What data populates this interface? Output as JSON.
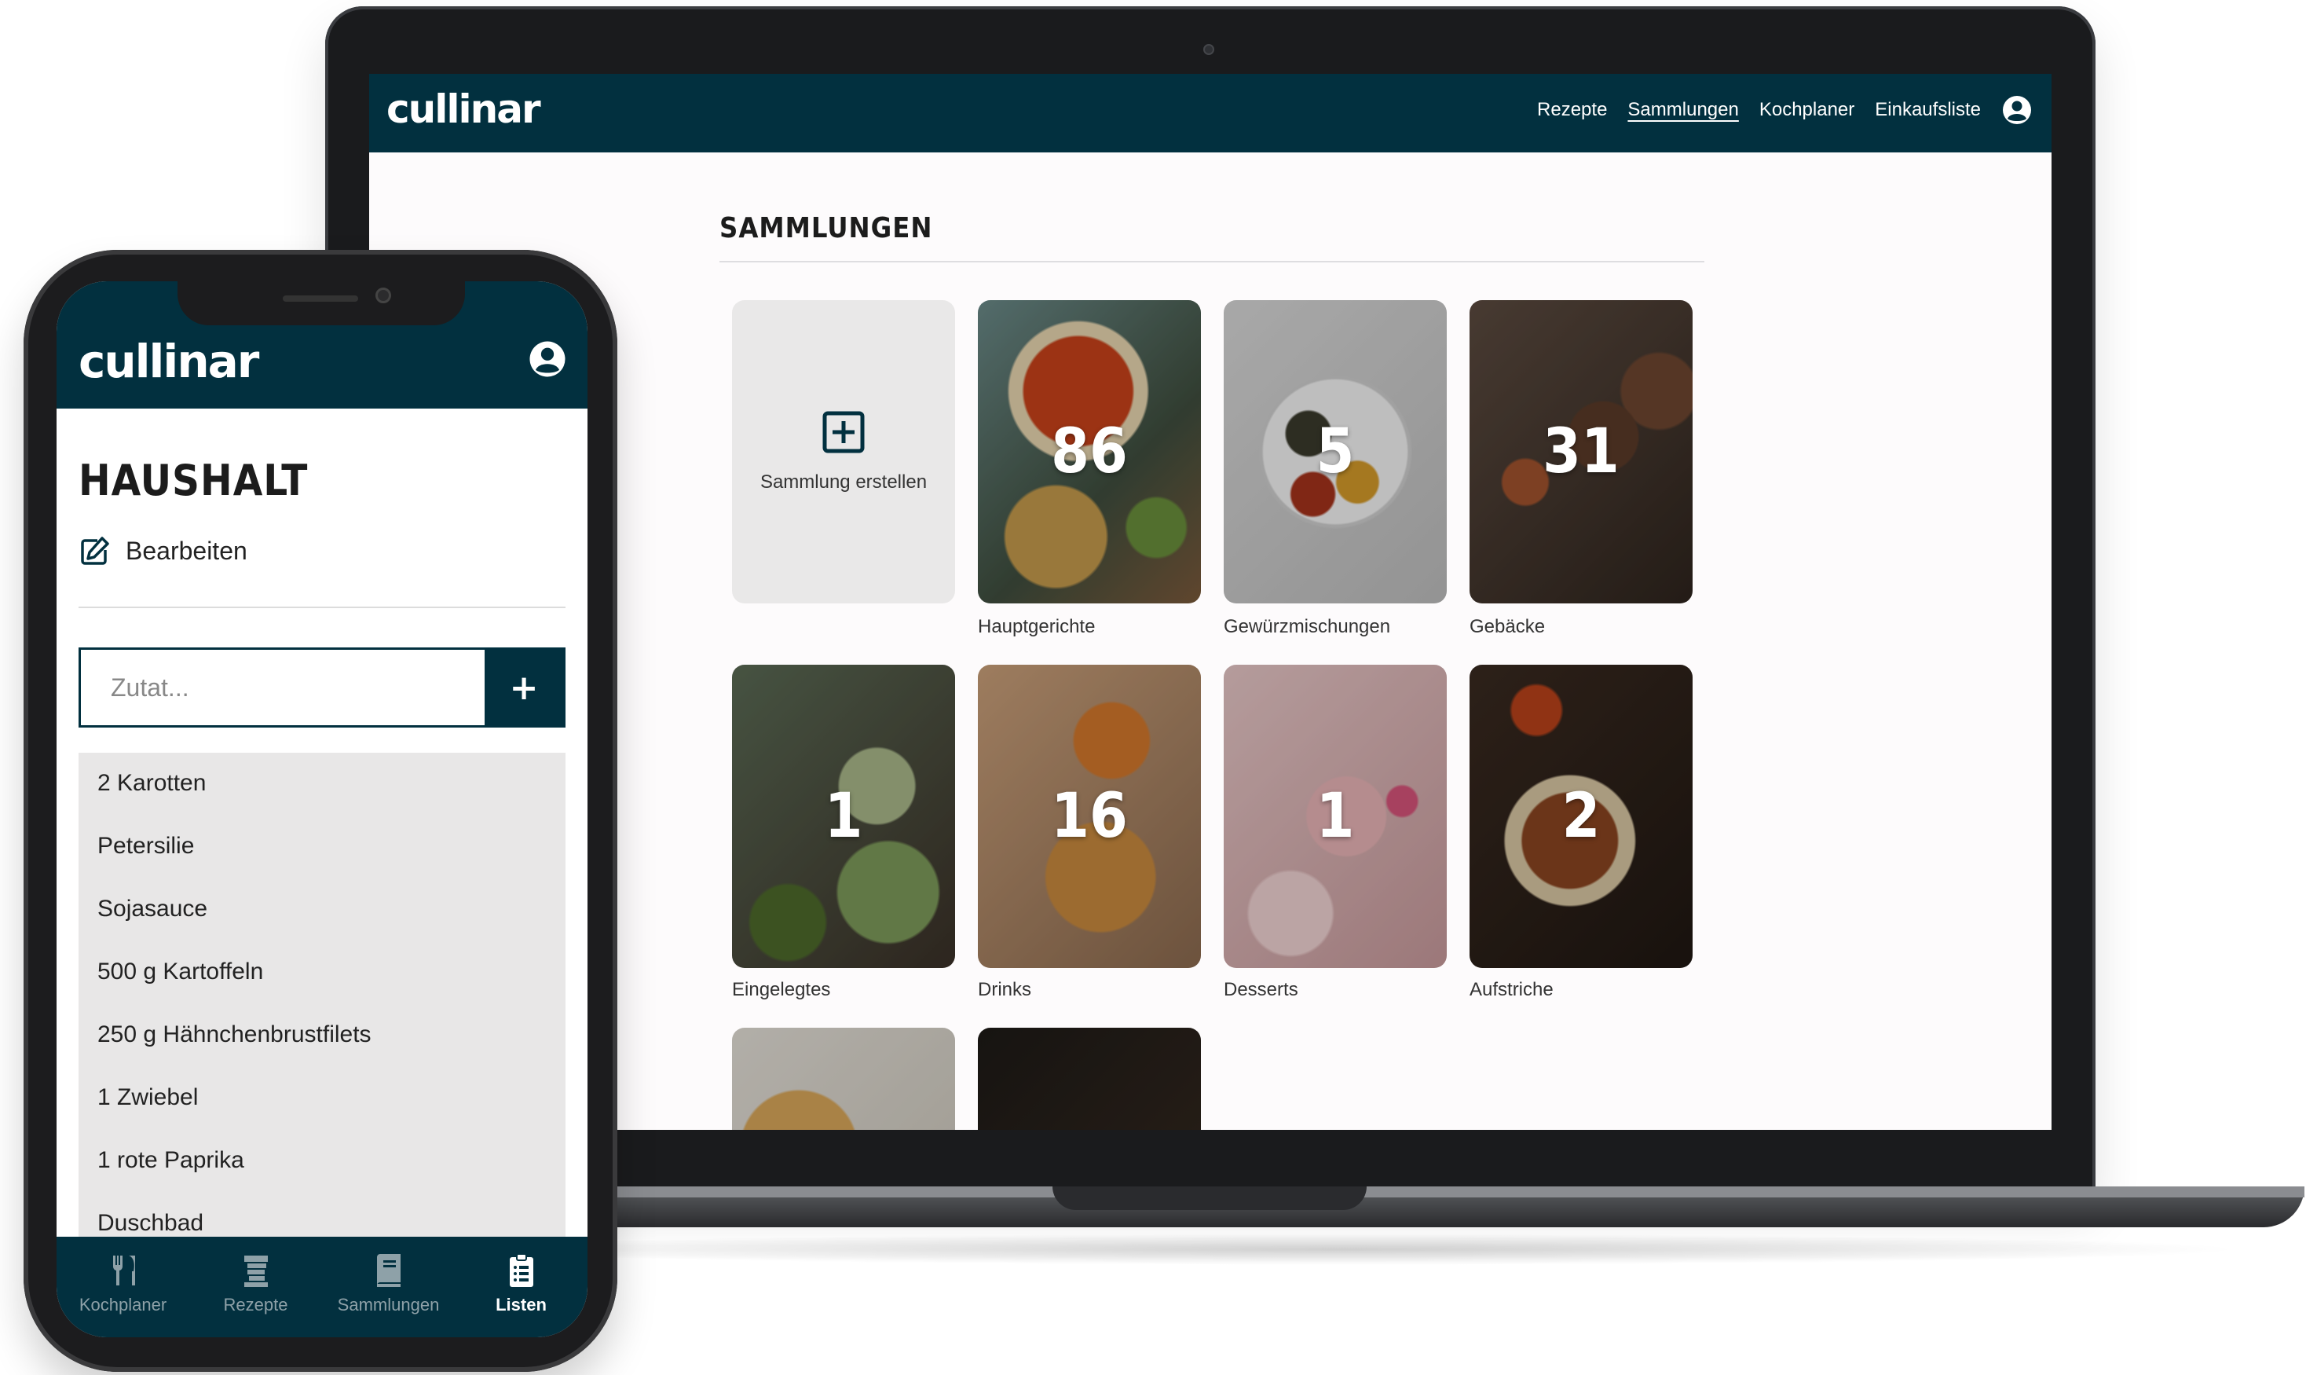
{
  "laptop": {
    "logo": "cullinar",
    "nav": [
      "Rezepte",
      "Sammlungen",
      "Kochplaner",
      "Einkaufsliste"
    ],
    "active_nav": "Sammlungen",
    "page_title": "SAMMLUNGEN",
    "create_label": "Sammlung erstellen",
    "collections": [
      {
        "name": "Hauptgerichte",
        "count": "86"
      },
      {
        "name": "Gewürzmischungen",
        "count": "5"
      },
      {
        "name": "Gebäcke",
        "count": "31"
      },
      {
        "name": "Eingelegtes",
        "count": "1"
      },
      {
        "name": "Drinks",
        "count": "16"
      },
      {
        "name": "Desserts",
        "count": "1"
      },
      {
        "name": "Aufstriche",
        "count": "2"
      }
    ]
  },
  "phone": {
    "logo": "cullinar",
    "list_title": "HAUSHALT",
    "edit_label": "Bearbeiten",
    "input_placeholder": "Zutat...",
    "add_label": "+",
    "items": [
      "2 Karotten",
      "Petersilie",
      "Sojasauce",
      "500 g Kartoffeln",
      "250 g Hähnchenbrustfilets",
      "1 Zwiebel",
      "1 rote Paprika",
      "Duschbad"
    ],
    "tabs": [
      "Kochplaner",
      "Rezepte",
      "Sammlungen",
      "Listen"
    ],
    "active_tab": "Listen"
  },
  "colors": {
    "brand": "#02303f",
    "tile_bg": "#e9e8e8",
    "list_bg": "#e8e7e7"
  }
}
